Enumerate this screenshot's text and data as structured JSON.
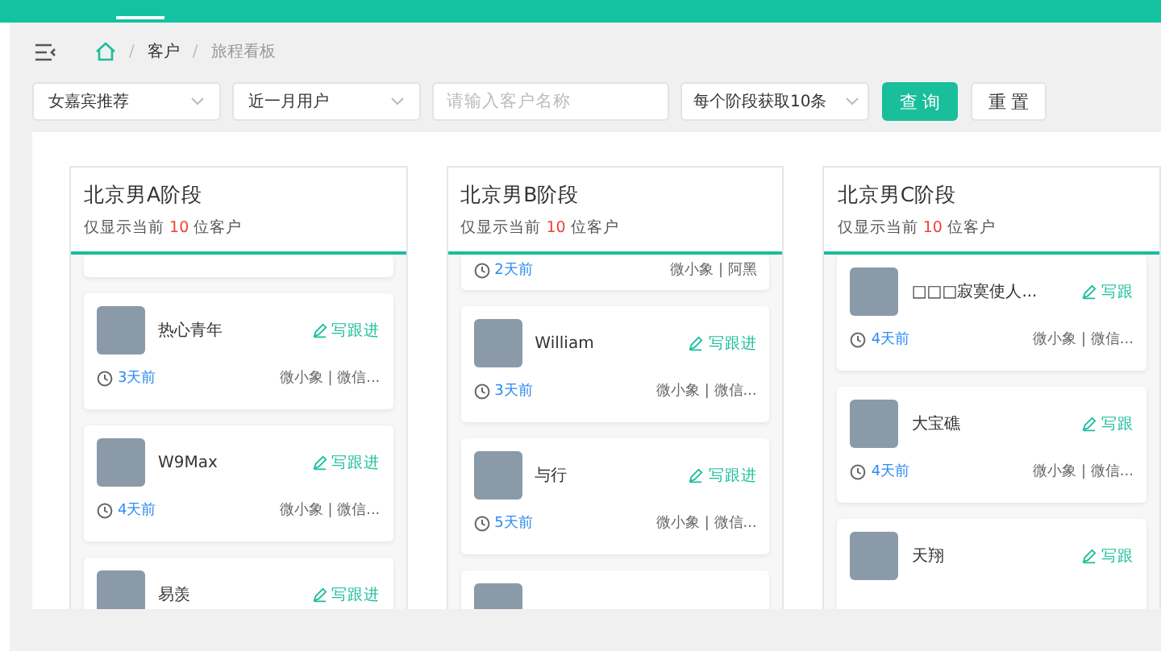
{
  "breadcrumb": [
    {
      "separator": "/",
      "label": "客户",
      "current": false
    },
    {
      "separator": "/",
      "label": "旅程看板",
      "current": true
    }
  ],
  "filters": {
    "selects": [
      "女嘉宾推荐",
      "近一月用户"
    ],
    "search": {
      "placeholder": "请输入客户名称"
    },
    "limit_select": "每个阶段获取10条"
  },
  "buttons": [
    {
      "label": "查 询",
      "kind": "primary"
    },
    {
      "label": "重 置",
      "kind": "default"
    }
  ],
  "columns": [
    {
      "title": "北京男A阶段",
      "note_prefix": "仅显示当前",
      "count": "10",
      "note_suffix": "位客户",
      "items": [
        {
          "kind": "fragment"
        },
        {
          "kind": "card",
          "name": "热心青年",
          "action": "写跟进",
          "time": "3天前",
          "source": "微小象 | 微信..."
        },
        {
          "kind": "card",
          "name": "W9Max",
          "action": "写跟进",
          "time": "4天前",
          "source": "微小象 | 微信..."
        },
        {
          "kind": "card",
          "name": "易羡",
          "action": "写跟进"
        }
      ]
    },
    {
      "title": "北京男B阶段",
      "note_prefix": "仅显示当前",
      "count": "10",
      "note_suffix": "位客户",
      "items": [
        {
          "kind": "fragment",
          "time": "2天前",
          "source": "微小象 | 阿黑"
        },
        {
          "kind": "card",
          "name": "William",
          "action": "写跟进",
          "time": "3天前",
          "source": "微小象 | 微信..."
        },
        {
          "kind": "card",
          "name": "与行",
          "action": "写跟进",
          "time": "5天前",
          "source": "微小象 | 微信..."
        },
        {
          "kind": "card"
        }
      ]
    },
    {
      "title": "北京男C阶段",
      "note_prefix": "仅显示当前",
      "count": "10",
      "note_suffix": "位客户",
      "items": [
        {
          "kind": "card",
          "name": "□□□寂寞使人...",
          "action": "写跟",
          "time": "4天前",
          "source": "微小象 | 微信..."
        },
        {
          "kind": "card",
          "name": "大宝礁",
          "action": "写跟",
          "time": "4天前",
          "source": "微小象 | 微信..."
        },
        {
          "kind": "card",
          "name": "天翔",
          "action": "写跟"
        }
      ]
    }
  ]
}
